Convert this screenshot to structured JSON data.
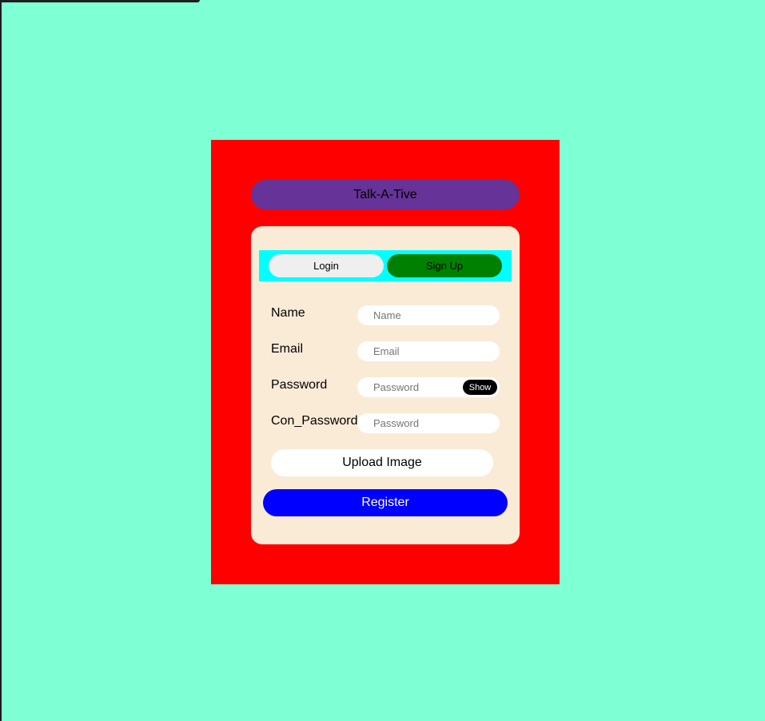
{
  "app": {
    "title": "Talk-A-Tive"
  },
  "tabs": {
    "login_label": "Login",
    "signup_label": "Sign Up"
  },
  "form": {
    "name": {
      "label": "Name",
      "placeholder": "Name",
      "value": ""
    },
    "email": {
      "label": "Email",
      "placeholder": "Email",
      "value": ""
    },
    "password": {
      "label": "Password",
      "placeholder": "Password",
      "value": "",
      "show_label": "Show"
    },
    "confirm_password": {
      "label": "Con_Password",
      "placeholder": "Password",
      "value": ""
    },
    "upload_label": "Upload Image",
    "register_label": "Register"
  },
  "colors": {
    "page_background": "#7fffd4",
    "outer_panel": "#ff0000",
    "title_pill": "#663399",
    "card": "#faebd7",
    "tab_strip": "#00ffff",
    "active_tab": "#008000",
    "register_button": "#0000ff"
  }
}
